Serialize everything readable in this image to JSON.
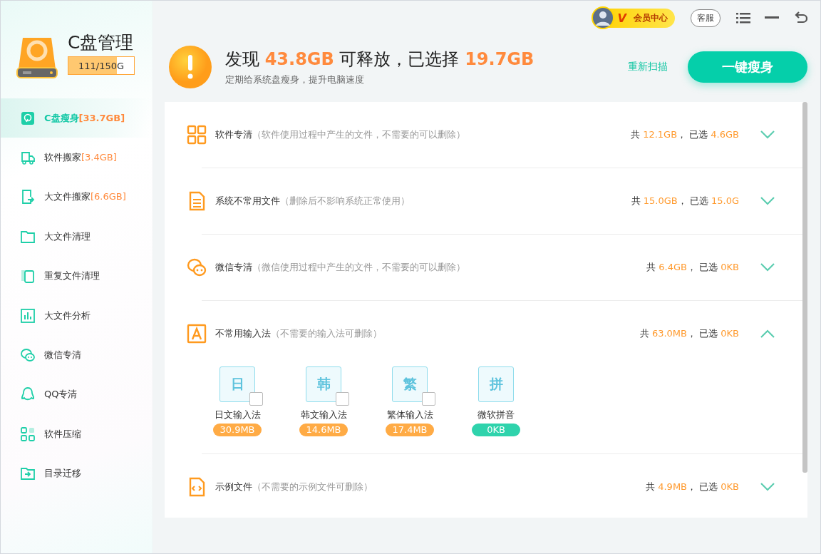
{
  "app": {
    "title": "C盘管理",
    "usage": {
      "text": "111/150G",
      "level": 0.74
    }
  },
  "top_bar": {
    "vip_label": "V",
    "vip_text": "会员中心",
    "support": "客服"
  },
  "sidebar": {
    "items": [
      {
        "label": "C盘瘦身",
        "size": "[33.7GB]",
        "selected": true
      },
      {
        "label": "软件搬家",
        "size": "[3.4GB]",
        "selected": false
      },
      {
        "label": "大文件搬家",
        "size": "[6.6GB]",
        "selected": false
      },
      {
        "label": "大文件清理",
        "selected": false
      },
      {
        "label": "重复文件清理",
        "selected": false
      },
      {
        "label": "大文件分析",
        "selected": false
      },
      {
        "label": "微信专清",
        "selected": false
      },
      {
        "label": "QQ专清",
        "selected": false
      },
      {
        "label": "软件压缩",
        "selected": false
      },
      {
        "label": "目录迁移",
        "selected": false
      }
    ]
  },
  "header": {
    "title": [
      {
        "text": "发现 ",
        "kind": "plain"
      },
      {
        "text": "43.8GB",
        "kind": "value"
      },
      {
        "text": " 可释放，已选择 ",
        "kind": "plain"
      },
      {
        "text": "19.7GB",
        "kind": "value"
      }
    ],
    "subtitle": "定期给系统盘瘦身，提升电脑速度",
    "rescan": "重新扫描",
    "action": "一键瘦身"
  },
  "categories": [
    {
      "name": "软件专清",
      "note": "（软件使用过程中产生的文件，不需要的可以删除）",
      "stats": [
        {
          "text": "共 ",
          "kind": "plain"
        },
        {
          "text": "12.1GB",
          "kind": "value"
        },
        {
          "text": "， 已选 ",
          "kind": "plain"
        },
        {
          "text": "4.6GB",
          "kind": "value"
        }
      ],
      "expanded": false
    },
    {
      "name": "系统不常用文件",
      "note": "（删除后不影响系统正常使用）",
      "stats": [
        {
          "text": "共 ",
          "kind": "plain"
        },
        {
          "text": "15.0GB",
          "kind": "value"
        },
        {
          "text": "， 已选 ",
          "kind": "plain"
        },
        {
          "text": "15.0G",
          "kind": "value"
        }
      ],
      "expanded": false
    },
    {
      "name": "微信专清",
      "note": "（微信使用过程中产生的文件，不需要的可以删除）",
      "stats": [
        {
          "text": "共 ",
          "kind": "plain"
        },
        {
          "text": "6.4GB",
          "kind": "value"
        },
        {
          "text": "， 已选 ",
          "kind": "plain"
        },
        {
          "text": "0KB",
          "kind": "value"
        }
      ],
      "expanded": false
    },
    {
      "name": "不常用输入法",
      "note": "（不需要的输入法可删除）",
      "stats": [
        {
          "text": "共 ",
          "kind": "plain"
        },
        {
          "text": "63.0MB",
          "kind": "value"
        },
        {
          "text": "， 已选 ",
          "kind": "plain"
        },
        {
          "text": "0KB",
          "kind": "value"
        }
      ],
      "expanded": true,
      "items": [
        {
          "glyph": "日",
          "name": "日文输入法",
          "size": "30.9MB",
          "kind": "removable",
          "checked": false
        },
        {
          "glyph": "韩",
          "name": "韩文输入法",
          "size": "14.6MB",
          "kind": "removable",
          "checked": false
        },
        {
          "glyph": "繁",
          "name": "繁体输入法",
          "size": "17.4MB",
          "kind": "removable",
          "checked": false
        },
        {
          "glyph": "拼",
          "name": "微软拼音",
          "size": "0KB",
          "kind": "builtin"
        }
      ]
    },
    {
      "name": "示例文件",
      "note": "（不需要的示例文件可删除）",
      "stats": [
        {
          "text": "共 ",
          "kind": "plain"
        },
        {
          "text": "4.9MB",
          "kind": "value"
        },
        {
          "text": "， 已选 ",
          "kind": "plain"
        },
        {
          "text": "0KB",
          "kind": "value"
        }
      ],
      "expanded": false
    }
  ]
}
